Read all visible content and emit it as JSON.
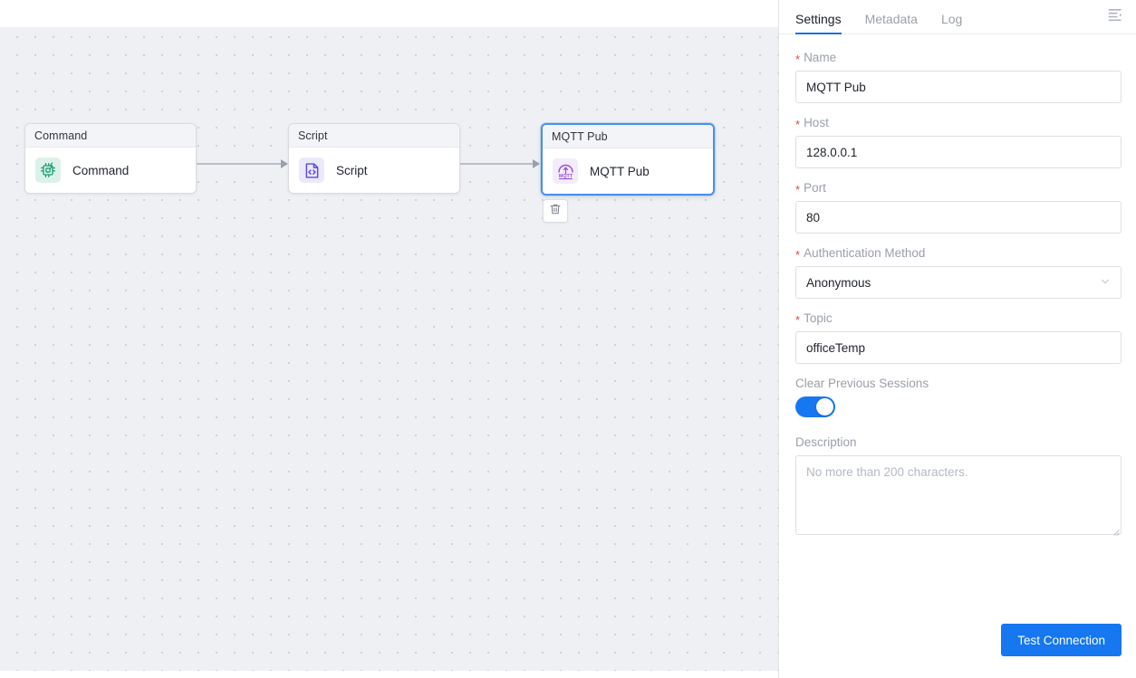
{
  "canvas": {
    "nodes": [
      {
        "header": "Command",
        "label": "Command",
        "icon": "chip-bolt-icon",
        "selected": false
      },
      {
        "header": "Script",
        "label": "Script",
        "icon": "code-file-icon",
        "selected": false
      },
      {
        "header": "MQTT Pub",
        "label": "MQTT Pub",
        "icon": "mqtt-logo-icon",
        "selected": true
      }
    ],
    "delete_button_icon": "trash-icon"
  },
  "panel": {
    "tabs": [
      {
        "label": "Settings",
        "active": true
      },
      {
        "label": "Metadata",
        "active": false
      },
      {
        "label": "Log",
        "active": false
      }
    ],
    "collapse_icon": "panel-collapse-icon",
    "fields": {
      "name": {
        "label": "Name",
        "required": true,
        "value": "MQTT Pub"
      },
      "host": {
        "label": "Host",
        "required": true,
        "value": "128.0.0.1"
      },
      "port": {
        "label": "Port",
        "required": true,
        "value": "80"
      },
      "auth_method": {
        "label": "Authentication Method",
        "required": true,
        "value": "Anonymous",
        "options": [
          "Anonymous"
        ],
        "chevron_icon": "chevron-down-icon"
      },
      "topic": {
        "label": "Topic",
        "required": true,
        "value": "officeTemp"
      },
      "clear_sessions": {
        "label": "Clear Previous Sessions",
        "required": false,
        "value": "on"
      },
      "description": {
        "label": "Description",
        "required": false,
        "value": "",
        "placeholder": "No more than 200 characters."
      }
    },
    "test_connection_label": "Test Connection",
    "required_marker": "*"
  },
  "colors": {
    "accent_blue": "#1677f0",
    "tab_underline": "#1a6fe8",
    "required_red": "#e04a4a",
    "selected_node_border": "#4a90e8",
    "canvas_bg": "#eef0f4",
    "command_icon": "#1f9d78",
    "script_icon": "#5b4ddb",
    "mqtt_icon": "#9b51d8"
  }
}
